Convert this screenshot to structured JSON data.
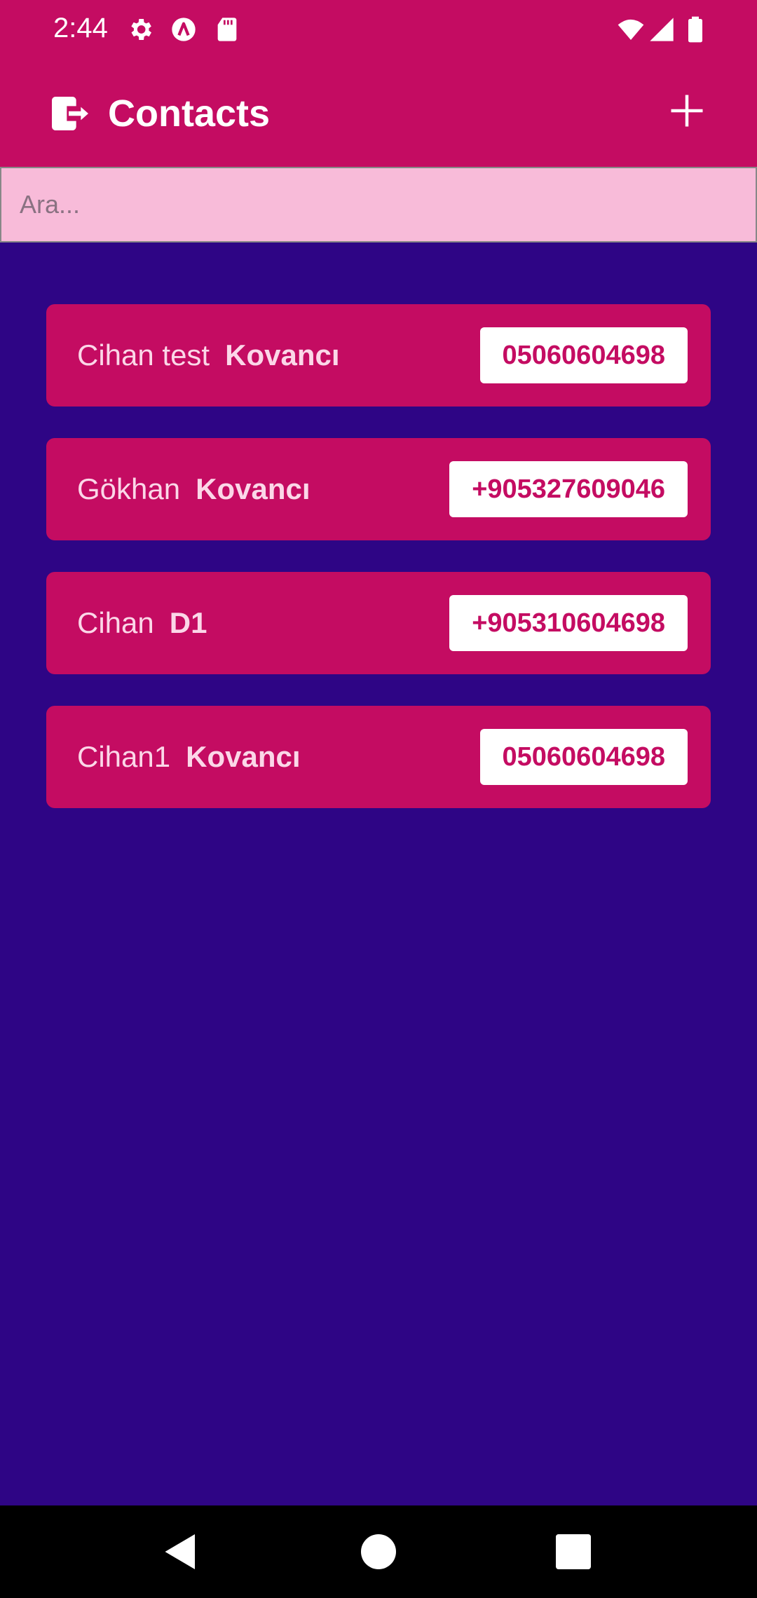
{
  "status_bar": {
    "time": "2:44",
    "icons": [
      "gear-icon",
      "accessibility-icon",
      "sd-card-icon",
      "wifi-icon",
      "signal-icon",
      "battery-icon"
    ]
  },
  "app_bar": {
    "title": "Contacts",
    "leading_icon": "logout-icon",
    "action_icon": "add-icon"
  },
  "search": {
    "placeholder": "Ara...",
    "value": ""
  },
  "contacts": [
    {
      "first": "Cihan test",
      "last": "Kovancı",
      "phone": "05060604698"
    },
    {
      "first": "Gökhan",
      "last": "Kovancı",
      "phone": "+905327609046"
    },
    {
      "first": "Cihan",
      "last": "D1",
      "phone": "+905310604698"
    },
    {
      "first": "Cihan1",
      "last": "Kovancı",
      "phone": "05060604698"
    }
  ],
  "nav_bar": {
    "icons": [
      "back-icon",
      "home-icon",
      "recents-icon"
    ]
  },
  "colors": {
    "primary": "#c40c62",
    "background": "#2e0585",
    "search_bg": "#f8bbd9",
    "nav_bg": "#000000"
  }
}
